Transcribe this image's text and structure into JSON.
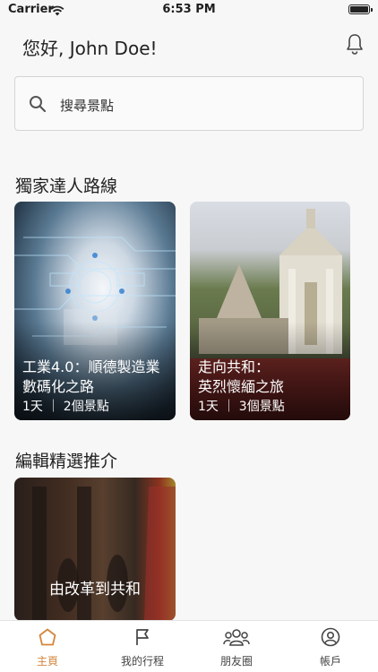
{
  "status_bar": {
    "carrier": "Carrier",
    "time": "6:53 PM"
  },
  "header": {
    "greeting": "您好, John Doe!",
    "bell_icon": "bell-icon"
  },
  "search": {
    "placeholder": "搜尋景點",
    "icon": "search-icon"
  },
  "sections": {
    "expert_routes": {
      "title": "獨家達人路線",
      "cards": [
        {
          "title_line1": "工業4.0：順德製造業",
          "title_line2": "數碼化之路",
          "meta": "1天 ｜ 2個景點"
        },
        {
          "title_line1": "走向共和：",
          "title_line2": "英烈懷緬之旅",
          "meta": "1天 ｜ 3個景點"
        }
      ]
    },
    "editor_picks": {
      "title": "編輯精選推介",
      "cards": [
        {
          "title": "由改革到共和"
        }
      ]
    }
  },
  "tabbar": {
    "accent": "#d5853a",
    "items": [
      {
        "label": "主頁",
        "icon": "home-icon",
        "active": true
      },
      {
        "label": "我的行程",
        "icon": "flag-icon",
        "active": false
      },
      {
        "label": "朋友圈",
        "icon": "friends-icon",
        "active": false
      },
      {
        "label": "帳戶",
        "icon": "account-icon",
        "active": false
      }
    ]
  }
}
